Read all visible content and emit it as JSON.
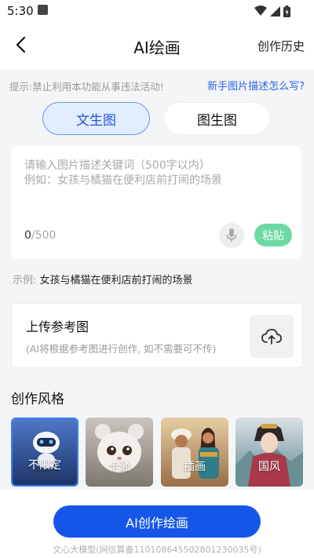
{
  "status_bar": {
    "time": "5:30"
  },
  "nav": {
    "title": "AI绘画",
    "history": "创作历史"
  },
  "hint": {
    "text": "提示:禁止利用本功能从事违法活动!",
    "link": "新手图片描述怎么写?"
  },
  "tabs": [
    {
      "label": "文生图",
      "selected": true
    },
    {
      "label": "图生图",
      "selected": false
    }
  ],
  "prompt": {
    "placeholder_line1": "请输入图片描述关键词（500字以内）",
    "placeholder_line2": "例如：女孩与橘猫在便利店前打闹的场景",
    "count_current": "0",
    "count_max": "/500",
    "paste_label": "粘贴"
  },
  "example": {
    "label": "示例:",
    "text": "女孩与橘猫在便利店前打闹的场景"
  },
  "upload": {
    "title": "上传参考图",
    "subtitle": "(AI将根据参考图进行创作, 如不需要可不传)"
  },
  "styles": {
    "title": "创作风格",
    "items": [
      {
        "label": "不限定",
        "icon": "robot-image",
        "selected": true
      },
      {
        "label": "卡通",
        "icon": "cartoon-cat-image",
        "selected": false
      },
      {
        "label": "插画",
        "icon": "illustration-people-image",
        "selected": false
      },
      {
        "label": "国风",
        "icon": "chinese-style-woman-image",
        "selected": false
      }
    ]
  },
  "action": {
    "create_label": "AI创作绘画"
  },
  "footer": {
    "text": "文心大模型(网信算备110108645502801230035号)"
  },
  "colors": {
    "accent": "#1556e8",
    "tab_active_bg": "#e2edff",
    "paste_green": "#6cd9a2"
  }
}
